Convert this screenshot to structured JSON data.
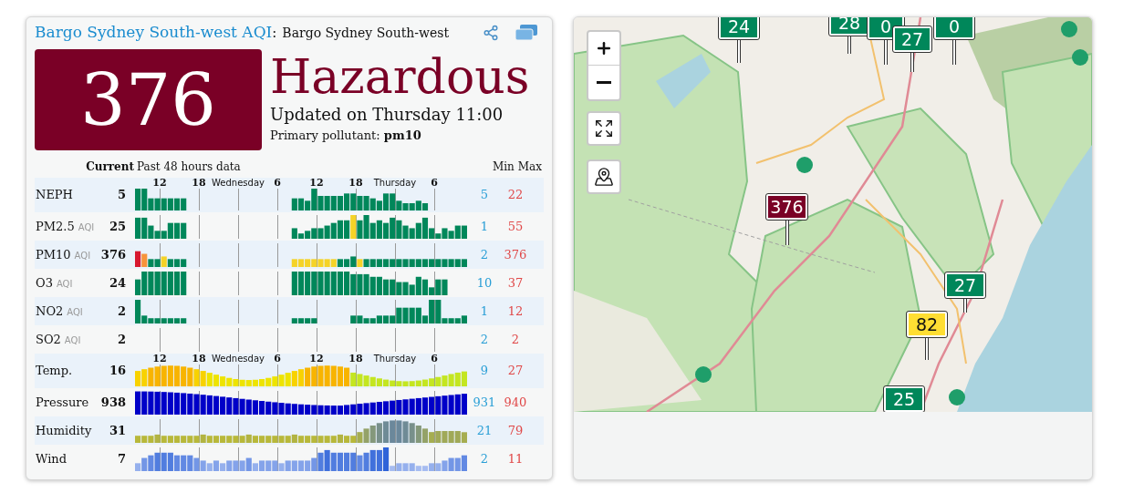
{
  "header": {
    "title_link": "Bargo Sydney South-west AQI",
    "separator": ":",
    "location": "Bargo Sydney South-west"
  },
  "aqi": {
    "value": "376",
    "category": "Hazardous",
    "updated": "Updated on Thursday 11:00",
    "primary_label": "Primary pollutant:",
    "primary_value": "pm10"
  },
  "table": {
    "col_current": "Current",
    "col_history": "Past 48 hours data",
    "col_min": "Min",
    "col_max": "Max",
    "rows": [
      {
        "name": "NEPH",
        "current": "5",
        "min": "5",
        "max": "22",
        "ticks": [
          {
            "label": "12",
            "kind": "hour"
          },
          {
            "label": "18",
            "kind": "hour"
          },
          {
            "label": "Wednesday",
            "kind": "day"
          },
          {
            "label": "6",
            "kind": "hour"
          },
          {
            "label": "12",
            "kind": "hour"
          },
          {
            "label": "18",
            "kind": "hour"
          },
          {
            "label": "Thursday",
            "kind": "day"
          },
          {
            "label": "6",
            "kind": "hour"
          }
        ]
      },
      {
        "name": "PM2.5",
        "suffix": "AQI",
        "current": "25",
        "min": "1",
        "max": "55"
      },
      {
        "name": "PM10",
        "suffix": "AQI",
        "current": "376",
        "min": "2",
        "max": "376"
      },
      {
        "name": "O3",
        "suffix": "AQI",
        "current": "24",
        "min": "10",
        "max": "37"
      },
      {
        "name": "NO2",
        "suffix": "AQI",
        "current": "2",
        "min": "1",
        "max": "12"
      },
      {
        "name": "SO2",
        "suffix": "AQI",
        "current": "2",
        "min": "2",
        "max": "2"
      },
      {
        "name": "Temp.",
        "current": "16",
        "min": "9",
        "max": "27",
        "ticks": [
          {
            "label": "12",
            "kind": "hour"
          },
          {
            "label": "18",
            "kind": "hour"
          },
          {
            "label": "Wednesday",
            "kind": "day"
          },
          {
            "label": "6",
            "kind": "hour"
          },
          {
            "label": "12",
            "kind": "hour"
          },
          {
            "label": "18",
            "kind": "hour"
          },
          {
            "label": "Thursday",
            "kind": "day"
          },
          {
            "label": "6",
            "kind": "hour"
          }
        ]
      },
      {
        "name": "Pressure",
        "current": "938",
        "min": "931",
        "max": "940"
      },
      {
        "name": "Humidity",
        "current": "31",
        "min": "21",
        "max": "79"
      },
      {
        "name": "Wind",
        "current": "7",
        "min": "2",
        "max": "11"
      }
    ]
  },
  "map": {
    "markers": [
      {
        "value": "24",
        "color": "#00875a"
      },
      {
        "value": "28",
        "color": "#00875a"
      },
      {
        "value": "0",
        "color": "#00875a"
      },
      {
        "value": "27",
        "color": "#00875a"
      },
      {
        "value": "0",
        "color": "#00875a"
      },
      {
        "value": "376",
        "color": "#7a0026"
      },
      {
        "value": "27",
        "color": "#00875a"
      },
      {
        "value": "82",
        "color": "#ffde33"
      },
      {
        "value": "25",
        "color": "#00875a"
      }
    ]
  }
}
